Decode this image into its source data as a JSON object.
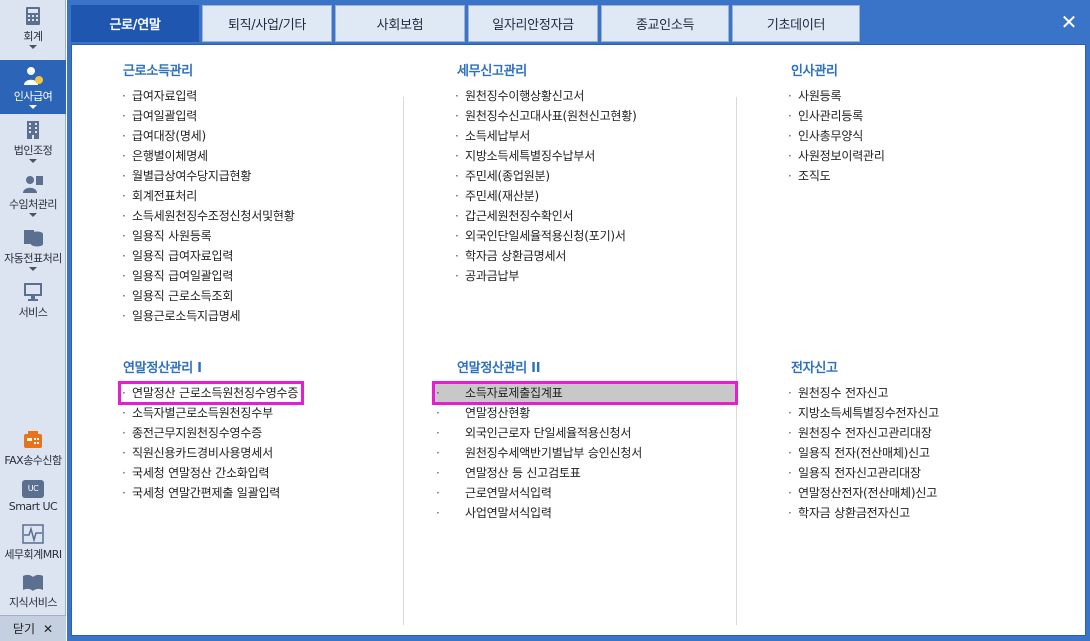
{
  "sidebar": {
    "items": [
      {
        "label": "회계",
        "icon": "calculator-icon"
      },
      {
        "label": "인사급여",
        "icon": "person-money-icon"
      },
      {
        "label": "법인조정",
        "icon": "building-icon"
      },
      {
        "label": "수임처관리",
        "icon": "people-icon"
      },
      {
        "label": "자동전표처리",
        "icon": "database-icon"
      },
      {
        "label": "서비스",
        "icon": "monitor-icon"
      },
      {
        "label": "FAX송수신함",
        "icon": "fax-icon"
      },
      {
        "label": "Smart UC",
        "icon": "uc-icon"
      },
      {
        "label": "세무회계MRI",
        "icon": "pulse-icon"
      },
      {
        "label": "지식서비스",
        "icon": "book-icon"
      }
    ],
    "uc_badge": "UC",
    "close_label": "닫기",
    "close_symbol": "✕"
  },
  "tabs": [
    "근로/연말",
    "퇴직/사업/기타",
    "사회보험",
    "일자리안정자금",
    "종교인소득",
    "기초데이터"
  ],
  "close_symbol": "✕",
  "sections": {
    "s1": {
      "title": "근로소득관리",
      "items": [
        "급여자료입력",
        "급여일괄입력",
        "급여대장(명세)",
        "은행별이체명세",
        "월별급상여수당지급현황",
        "회계전표처리",
        "소득세원천징수조정신청서및현황",
        "일용직 사원등록",
        "일용직 급여자료입력",
        "일용직 급여일괄입력",
        "일용직 근로소득조회",
        "일용근로소득지급명세"
      ]
    },
    "s2": {
      "title": "세무신고관리",
      "items": [
        "원천징수이행상황신고서",
        "원천징수신고대사표(원천신고현황)",
        "소득세납부서",
        "지방소득세특별징수납부서",
        "주민세(종업원분)",
        "주민세(재산분)",
        "갑근세원천징수확인서",
        "외국인단일세율적용신청(포기)서",
        "학자금 상환금명세서",
        "공과금납부"
      ]
    },
    "s3": {
      "title": "인사관리",
      "items": [
        "사원등록",
        "인사관리등록",
        "인사총무양식",
        "사원정보이력관리",
        "조직도"
      ]
    },
    "s4": {
      "title": "연말정산관리 I",
      "items": [
        "연말정산 근로소득원천징수영수증",
        "소득자별근로소득원천징수부",
        "종전근무지원천징수영수증",
        "직원신용카드경비사용명세서",
        "국세청 연말정산 간소화입력",
        "국세청 연말간편제출 일괄입력"
      ]
    },
    "s5": {
      "title": "연말정산관리 II",
      "items": [
        "소득자료제출집계표",
        "연말정산현황",
        "외국인근로자 단일세율적용신청서",
        "원천징수세액반기별납부 승인신청서",
        "연말정산 등 신고검토표",
        "근로연말서식입력",
        "사업연말서식입력"
      ]
    },
    "s6": {
      "title": "전자신고",
      "items": [
        "원천징수 전자신고",
        "지방소득세특별징수전자신고",
        "원천징수 전자신고관리대장",
        "일용직 전자(전산매체)신고",
        "일용직 전자신고관리대장",
        "연말정산전자(전산매체)신고",
        "학자금 상환금전자신고"
      ]
    }
  },
  "colors": {
    "accent": "#3a74c8",
    "active_tab": "#1f57b0",
    "section_title": "#2d6fc1",
    "highlight": "#e51ed1"
  }
}
